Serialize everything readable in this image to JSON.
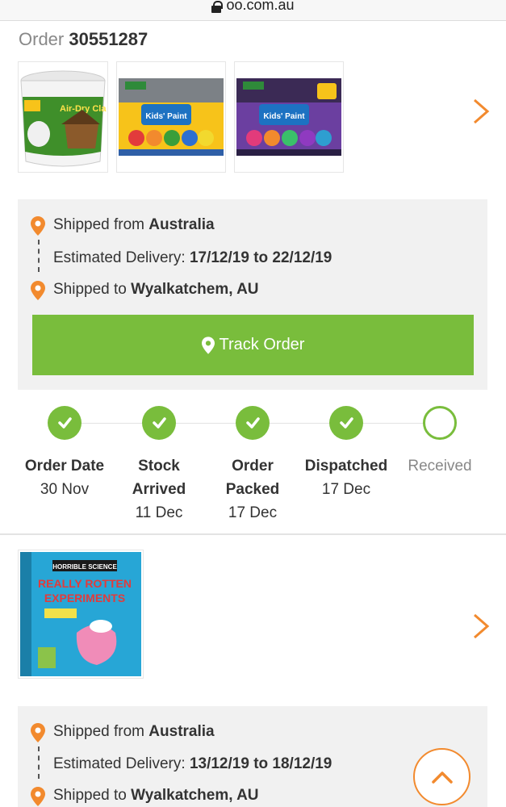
{
  "browser": {
    "url": "oo.com.au"
  },
  "order": {
    "label": "Order",
    "number": "30551287"
  },
  "products_1": [
    {
      "name": "Air-Dry Clay"
    },
    {
      "name": "Washable Kids' Paint"
    },
    {
      "name": "Washable Kids' Paint Glitter"
    }
  ],
  "shipment_1": {
    "from_label": "Shipped from ",
    "from_value": "Australia",
    "eta_label": "Estimated Delivery: ",
    "eta_value": "17/12/19 to 22/12/19",
    "to_label": "Shipped to ",
    "to_value": "Wyalkatchem, AU",
    "track_label": "Track Order"
  },
  "progress": [
    {
      "label_line1": "Order Date",
      "label_line2": "",
      "date": "30 Nov",
      "done": true
    },
    {
      "label_line1": "Stock",
      "label_line2": "Arrived",
      "date": "11 Dec",
      "done": true
    },
    {
      "label_line1": "Order",
      "label_line2": "Packed",
      "date": "17 Dec",
      "done": true
    },
    {
      "label_line1": "Dispatched",
      "label_line2": "",
      "date": "17 Dec",
      "done": true
    },
    {
      "label_line1": "Received",
      "label_line2": "",
      "date": "",
      "done": false
    }
  ],
  "products_2": [
    {
      "name": "Horrible Science Really Rotten Experiments"
    }
  ],
  "shipment_2": {
    "from_label": "Shipped from ",
    "from_value": "Australia",
    "eta_label": "Estimated Delivery: ",
    "eta_value": "13/12/19 to 18/12/19",
    "to_label": "Shipped to ",
    "to_value": "Wyalkatchem, AU"
  },
  "colors": {
    "accent": "#f28a2e",
    "green": "#79bd3c",
    "panel": "#f1f1f1"
  },
  "icons": {
    "pin": "map-pin-icon",
    "chevron": "chevron-right-icon",
    "check": "check-icon",
    "up": "chevron-up-icon",
    "lock": "lock-icon"
  }
}
